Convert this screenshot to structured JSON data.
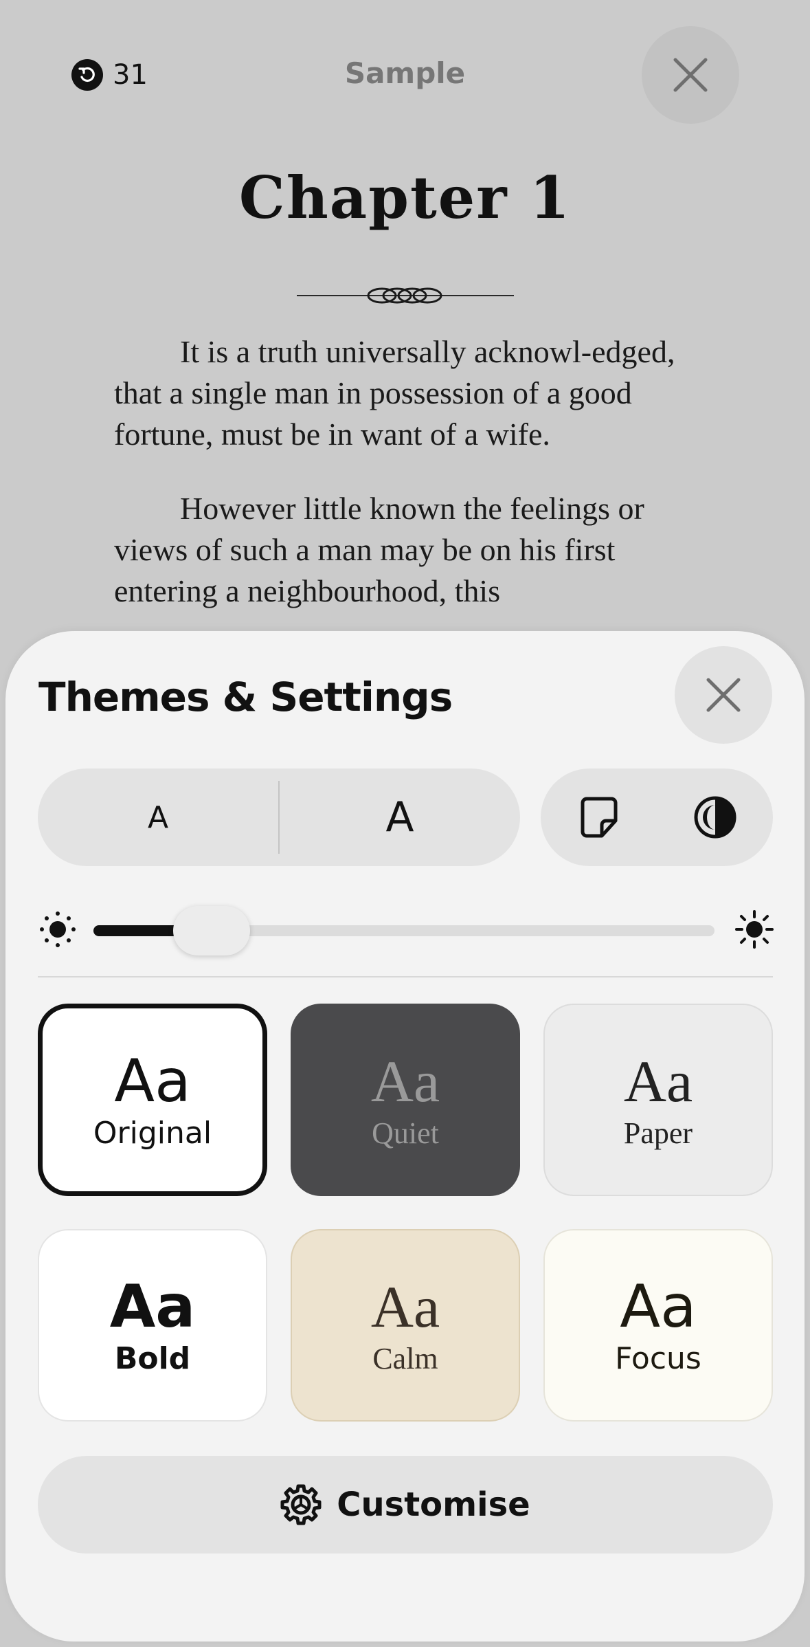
{
  "reader": {
    "badge_count": "31",
    "sample_title": "Sample",
    "chapter_title": "Chapter 1",
    "paragraphs": [
      "It is a truth universally acknowl-edged, that a single man in possession of a good fortune, must be in want of a wife.",
      "However little known the feelings or views of such a man may be on his first entering a neighbourhood, this"
    ]
  },
  "sheet": {
    "title": "Themes & Settings",
    "font_small_label": "A",
    "font_large_label": "A",
    "brightness_level": 0.19,
    "themes": [
      {
        "name": "Original",
        "sample": "Aa",
        "selected": true
      },
      {
        "name": "Quiet",
        "sample": "Aa"
      },
      {
        "name": "Paper",
        "sample": "Aa"
      },
      {
        "name": "Bold",
        "sample": "Aa"
      },
      {
        "name": "Calm",
        "sample": "Aa"
      },
      {
        "name": "Focus",
        "sample": "Aa"
      }
    ],
    "customise_label": "Customise"
  },
  "icons": {
    "back": "counterclockwise-arrow-icon",
    "close": "close-icon",
    "page_layout": "page-icon",
    "appearance": "contrast-icon",
    "brightness_low": "sun-small-icon",
    "brightness_high": "sun-large-icon",
    "customise": "gear-icon"
  },
  "colors": {
    "sheet_background": "#f3f3f3",
    "quiet_theme": "#4a4a4c",
    "calm_theme": "#ede3cf",
    "focus_theme": "#fcfbf4"
  }
}
